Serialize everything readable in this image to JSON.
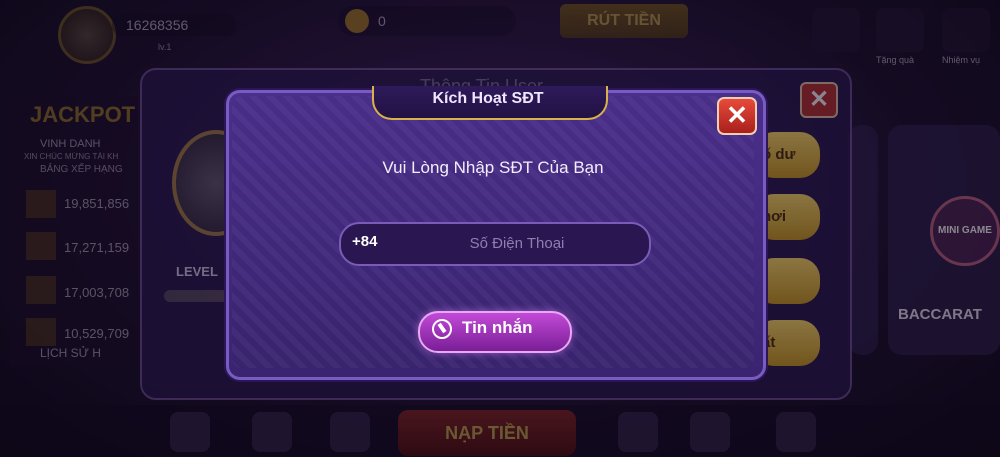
{
  "topbar": {
    "user_id": "16268356",
    "level": "lv.1",
    "balance": "0",
    "withdraw_label": "RÚT TIỀN",
    "gift_label": "Tặng quà",
    "mission_label": "Nhiệm vụ"
  },
  "jackpot": {
    "title": "JACKPOT",
    "vinh_danh": "VINH DANH",
    "congrats": "XIN CHÚC MỪNG TÀI KH",
    "leaderboard": "BẢNG XẾP HẠNG",
    "amounts": [
      "19,851,856",
      "17,271,159",
      "17,003,708",
      "10,529,709"
    ],
    "history": "LỊCH SỬ H"
  },
  "info_panel": {
    "title": "Thông Tin User",
    "close": "✕",
    "level_label": "LEVEL",
    "side_buttons": [
      "ố dư",
      "hơi",
      "",
      "ất"
    ]
  },
  "games": {
    "baccarat": "BACCARAT",
    "mini_game": "MINI GAME"
  },
  "bottombar": {
    "deposit_label": "NẠP TIỀN"
  },
  "modal": {
    "title": "Kích Hoạt SĐT",
    "close": "✕",
    "prompt": "Vui Lòng Nhập SĐT Của Bạn",
    "phone_prefix": "+84",
    "phone_placeholder": "Số Điện Thoại",
    "phone_value": "",
    "sms_button": "Tin nhắn"
  }
}
